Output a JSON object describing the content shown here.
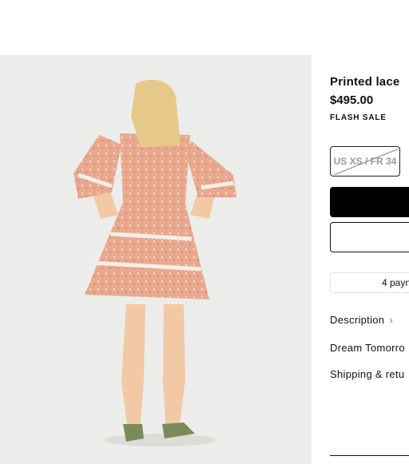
{
  "product": {
    "title": "Printed lace",
    "price": "$495.00",
    "badge": "FLASH SALE",
    "image_alt": "model wearing pink floral print mini dress with lace trim, back view"
  },
  "sizes": [
    {
      "label": "US XS / FR 34",
      "available": false
    }
  ],
  "buttons": {
    "add_to_bag": "",
    "wishlist": ""
  },
  "payment": {
    "text": "4 payn"
  },
  "sections": {
    "description": "Description",
    "description_icon": "chevron-right-icon",
    "dream_tomorrow": "Dream Tomorro",
    "shipping": "Shipping & retu"
  },
  "colors": {
    "primary": "#000000",
    "dress_pink": "#e8a88e",
    "background": "#ffffff"
  }
}
